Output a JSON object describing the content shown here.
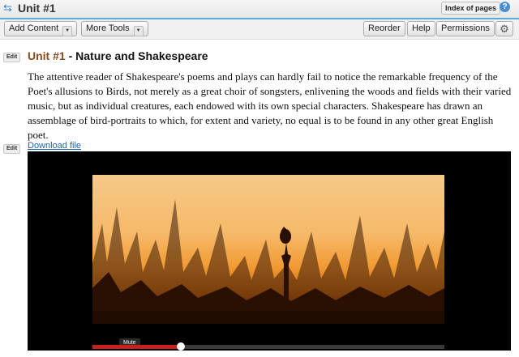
{
  "header": {
    "title": "Unit #1",
    "index_label": "Index of pages",
    "help_glyph": "?"
  },
  "toolbar": {
    "add_content": "Add Content",
    "more_tools": "More Tools",
    "reorder": "Reorder",
    "help": "Help",
    "permissions": "Permissions"
  },
  "content": {
    "edit_label": "Edit",
    "unit_number": "Unit #1",
    "unit_separator": " - ",
    "unit_name": "Nature and Shakespeare",
    "paragraph": "The attentive reader of Shakespeare's poems and plays can hardly fail to notice the remarkable frequency of the Poet's allusions to Birds, not merely as a great choir of songsters, enlivening the woods and fields with their varied music, but as individual creatures, each endowed with its own special characters. Shakespeare has drawn an assemblage of bird-portraits to which, for extent and variety, no equal is to be found in any other great English poet.",
    "download_link": "Download file"
  },
  "player": {
    "mute_tooltip": "Mute",
    "progress": 0.25,
    "colors": {
      "progress_fill": "#c81f1f",
      "link": "#1a5fb4",
      "title_accent": "#8a4b1d"
    }
  }
}
